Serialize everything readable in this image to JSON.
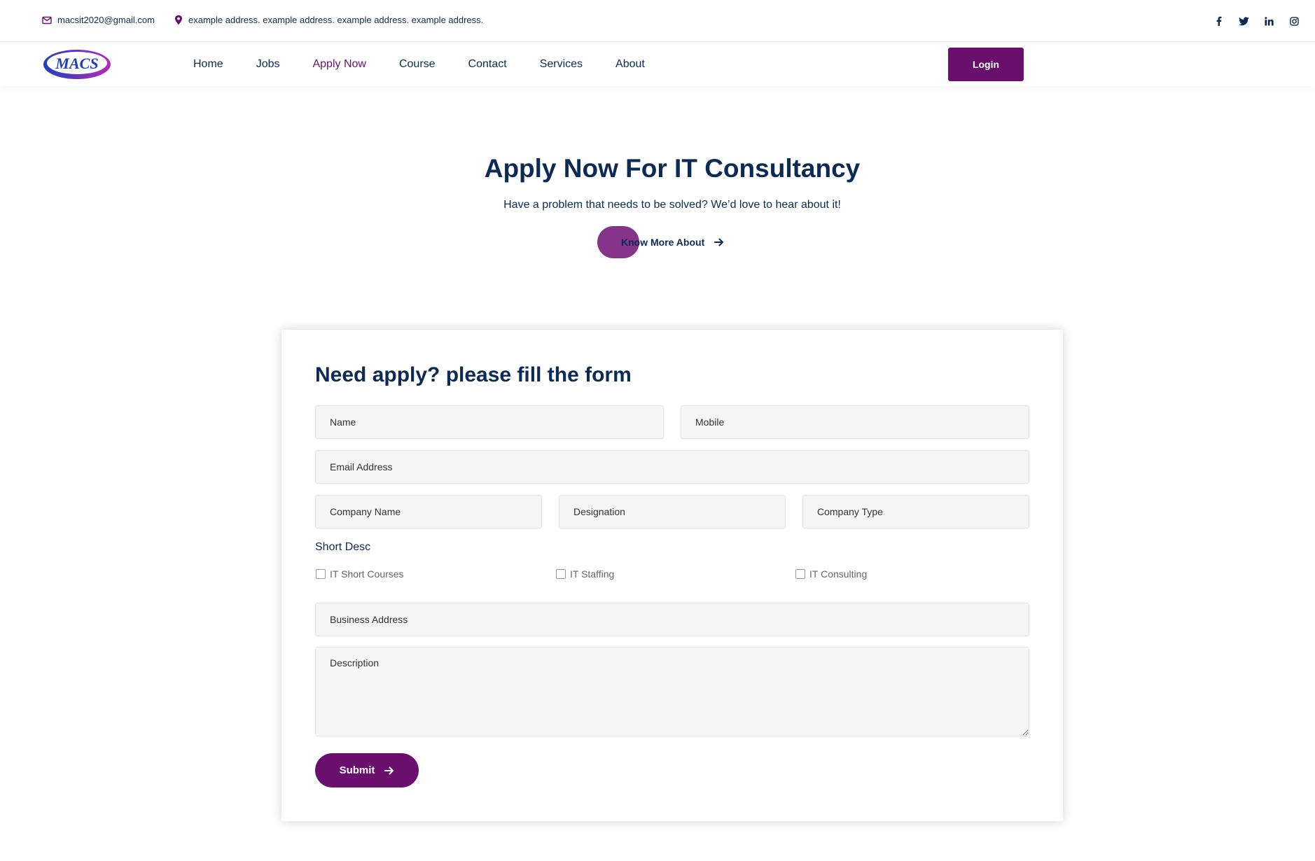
{
  "topbar": {
    "email": "macsit2020@gmail.com",
    "address": "example address. example address. example address. example address.",
    "social": [
      "facebook-icon",
      "twitter-icon",
      "linkedin-icon",
      "instagram-icon"
    ]
  },
  "brand": {
    "logo_text": "MACS"
  },
  "nav": {
    "items": [
      "Home",
      "Jobs",
      "Apply Now",
      "Course",
      "Contact",
      "Services",
      "About"
    ],
    "active": "Apply Now",
    "login_label": "Login"
  },
  "hero": {
    "title": "Apply Now For IT Consultancy",
    "subtitle": "Have a problem that needs to be solved? We’d love to hear about it!",
    "cta_label": "Know More About"
  },
  "form": {
    "heading": "Need apply? please fill the form",
    "name_placeholder": "Name",
    "mobile_placeholder": "Mobile",
    "email_placeholder": "Email Address",
    "company_name_placeholder": "Company Name",
    "designation_placeholder": "Designation",
    "company_type_placeholder": "Company Type",
    "short_desc_label": "Short Desc",
    "checkboxes": [
      "IT Short Courses",
      "IT Staffing",
      "IT Consulting"
    ],
    "business_address_placeholder": "Business Address",
    "description_placeholder": "Description",
    "submit_label": "Submit"
  },
  "colors": {
    "brand_purple": "#6b0f6f",
    "cta_blob": "#86338a",
    "navy_text": "#0b2a55"
  }
}
